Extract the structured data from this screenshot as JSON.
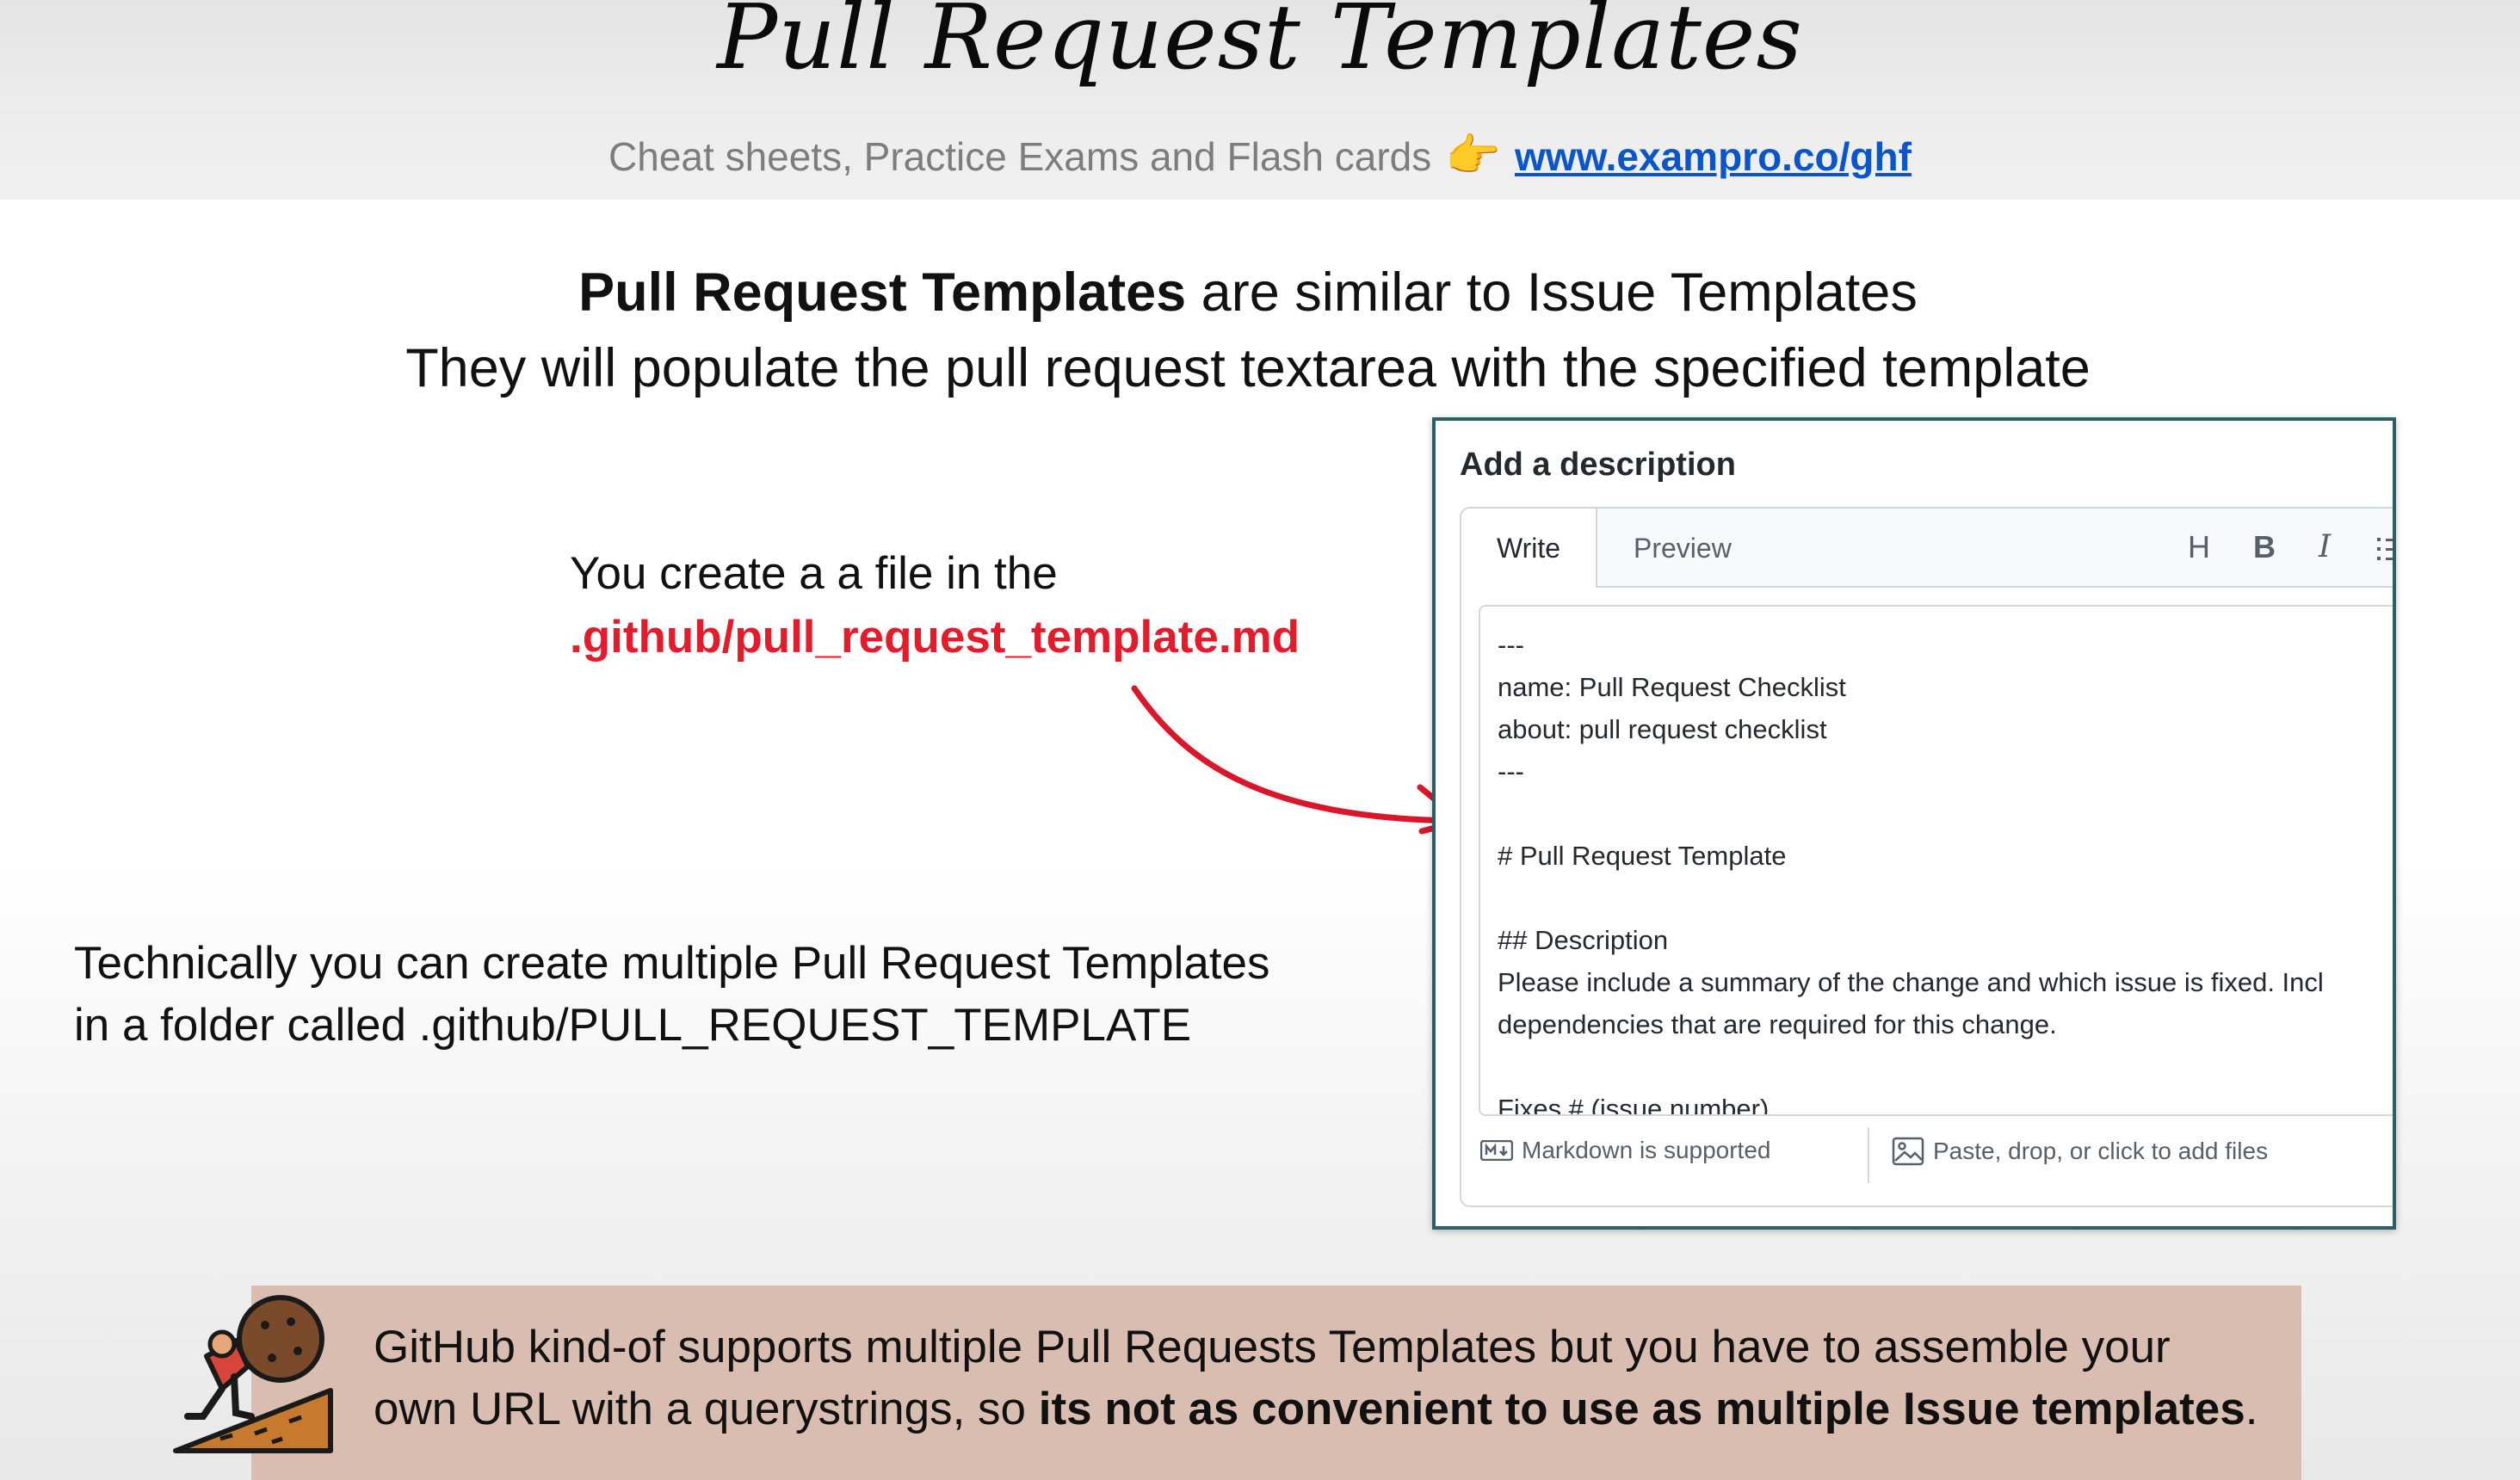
{
  "slide": {
    "title": "Pull Request Templates",
    "subline_text": "Cheat sheets, Practice Exams and Flash cards",
    "pointer_emoji": "👉",
    "subline_link": "www.exampro.co/ghf",
    "lead_bold": "Pull Request Templates",
    "lead_rest": " are similar to Issue Templates",
    "lead_line2": "They will populate the pull request textarea with the specified template",
    "create_line1": "You create a a file in the",
    "create_path": ".github/pull_request_template.md",
    "multi_line1": "Technically you can create multiple Pull Request Templates",
    "multi_line2": "in a folder called .github/PULL_REQUEST_TEMPLATE",
    "callout_part1": "GitHub kind-of supports multiple Pull Requests Templates but you have to assemble your",
    "callout_part2": "own URL with a querystrings, so ",
    "callout_bold": "its not as convenient to use as multiple Issue templates",
    "callout_end": "."
  },
  "panel": {
    "title": "Add a description",
    "tab_write": "Write",
    "tab_preview": "Preview",
    "tool_heading": "H",
    "tool_bold": "B",
    "tool_italic": "I",
    "lines": [
      "---",
      "name: Pull Request Checklist",
      "about: pull request checklist",
      "---",
      "",
      "# Pull Request Template",
      "",
      "## Description",
      "Please include a summary of the change and which issue is fixed. Incl",
      "dependencies that are required for this change.",
      "",
      "Fixes # (issue number)"
    ],
    "footer_markdown": "Markdown is supported",
    "footer_files": "Paste, drop, or click to add files"
  },
  "colors": {
    "link": "#0a55c9",
    "path_red": "#e41b2b",
    "panel_border": "#2d5f66",
    "callout_bg": "#d9bdb0"
  }
}
